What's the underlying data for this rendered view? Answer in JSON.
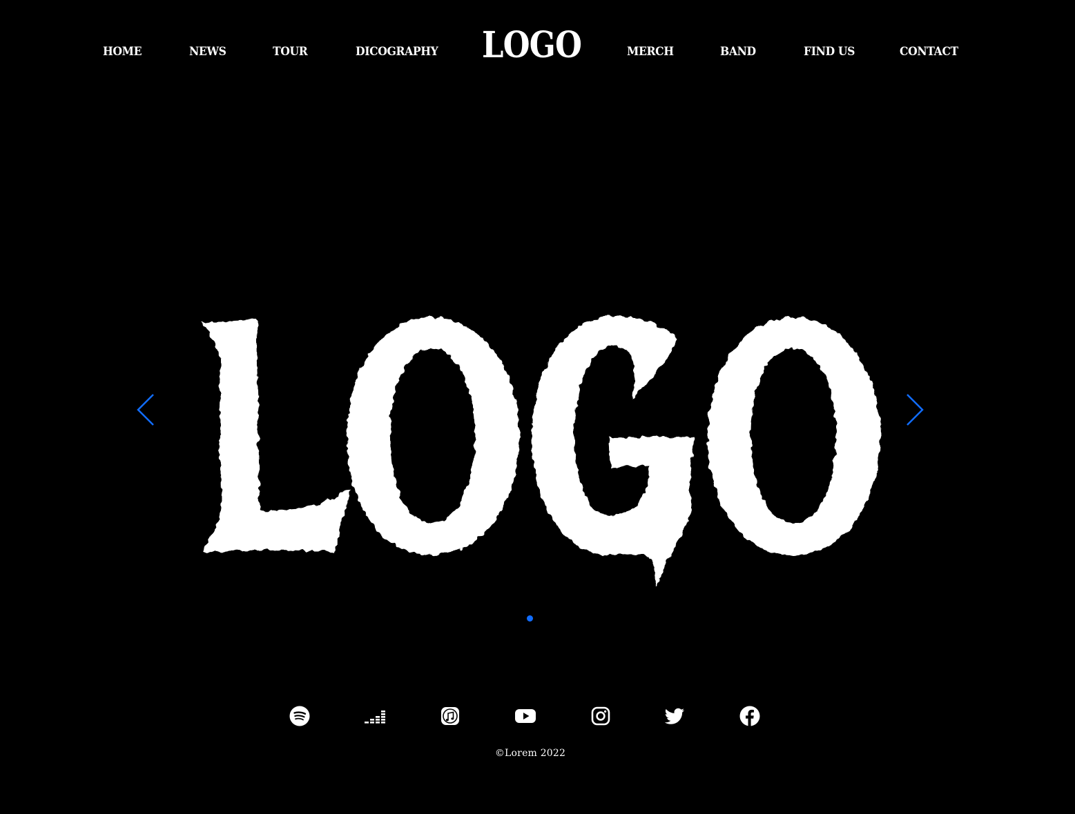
{
  "nav": {
    "left_items": [
      {
        "label": "HOME"
      },
      {
        "label": "NEWS"
      },
      {
        "label": "TOUR"
      },
      {
        "label": "DICOGRAPHY"
      }
    ],
    "logo": "LOGO",
    "right_items": [
      {
        "label": "MERCH"
      },
      {
        "label": "BAND"
      },
      {
        "label": "FIND US"
      },
      {
        "label": "CONTACT"
      }
    ]
  },
  "slideshow": {
    "hero_logo_text": "LOGO",
    "prev_icon": "chevron-left-icon",
    "next_icon": "chevron-right-icon",
    "slide_count": 1,
    "active_slide": 1,
    "accent_color": "#116dff"
  },
  "social": [
    {
      "name": "spotify",
      "icon": "spotify-icon"
    },
    {
      "name": "deezer",
      "icon": "deezer-icon"
    },
    {
      "name": "itunes",
      "icon": "itunes-icon"
    },
    {
      "name": "youtube",
      "icon": "youtube-icon"
    },
    {
      "name": "instagram",
      "icon": "instagram-icon"
    },
    {
      "name": "twitter",
      "icon": "twitter-icon"
    },
    {
      "name": "facebook",
      "icon": "facebook-icon"
    }
  ],
  "footer": {
    "copyright": "©Lorem 2022"
  },
  "colors": {
    "background": "#000000",
    "text": "#ffffff",
    "accent": "#116dff"
  }
}
